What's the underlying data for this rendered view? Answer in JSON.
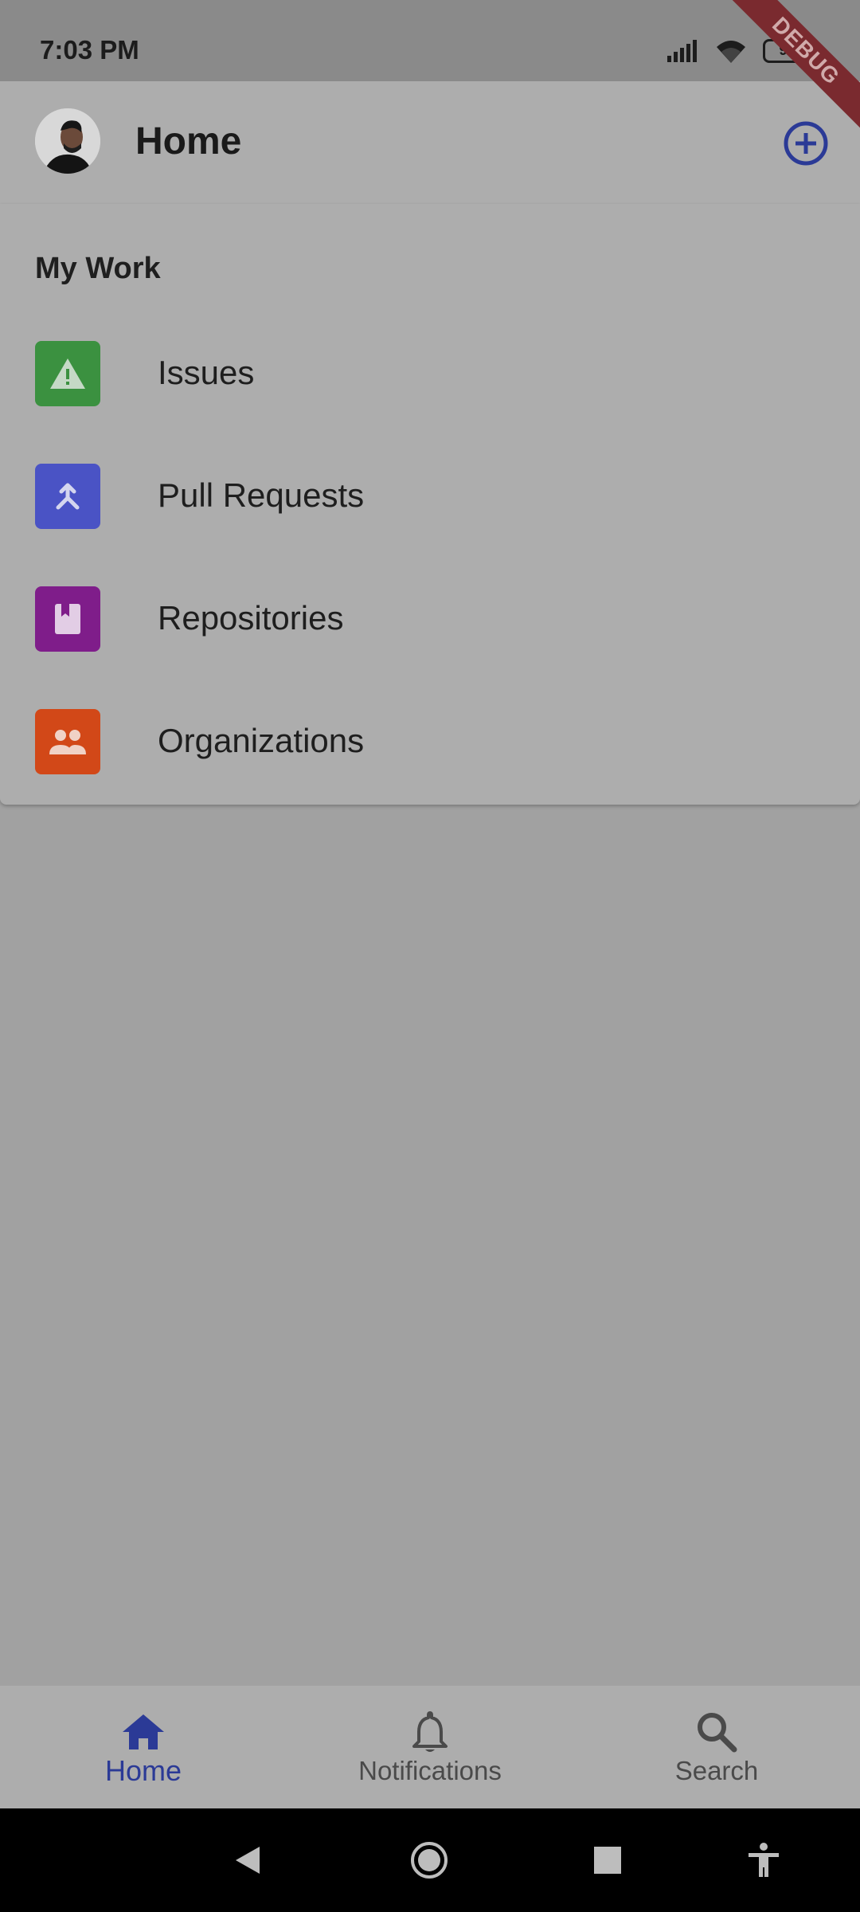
{
  "status_bar": {
    "time": "7:03 PM",
    "battery": "96",
    "debug_banner": "DEBUG"
  },
  "app_bar": {
    "title": "Home",
    "avatar_icon": "user-avatar",
    "action_icon": "add-circle-icon"
  },
  "my_work": {
    "title": "My Work",
    "items": [
      {
        "label": "Issues",
        "icon": "warning-icon",
        "color": "#3b9140"
      },
      {
        "label": "Pull Requests",
        "icon": "merge-icon",
        "color": "#4a53c5"
      },
      {
        "label": "Repositories",
        "icon": "book-icon",
        "color": "#7f1d8a"
      },
      {
        "label": "Organizations",
        "icon": "people-icon",
        "color": "#d24818"
      }
    ]
  },
  "bottom_nav": {
    "items": [
      {
        "label": "Home",
        "icon": "home-icon",
        "active": true
      },
      {
        "label": "Notifications",
        "icon": "bell-icon",
        "active": false
      },
      {
        "label": "Search",
        "icon": "search-icon",
        "active": false
      }
    ],
    "active_color": "#2b3a96",
    "inactive_color": "#4a4a4a"
  },
  "system_nav": {
    "buttons": [
      "back-icon",
      "home-circle-icon",
      "recents-icon",
      "accessibility-icon"
    ]
  }
}
